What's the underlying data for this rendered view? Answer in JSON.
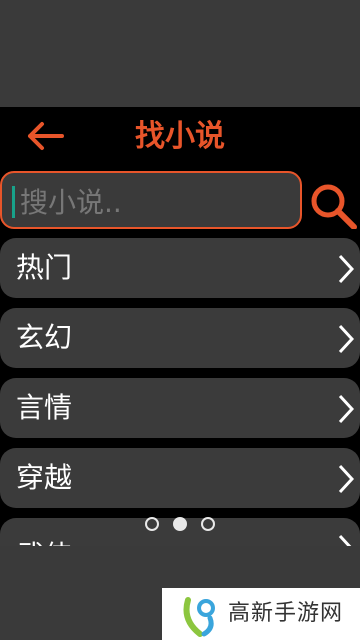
{
  "colors": {
    "accent": "#e8552a",
    "background": "#000000",
    "item_bg": "#3b3b3b",
    "caret": "#18a28a"
  },
  "header": {
    "back_icon": "arrow-left-icon",
    "title": "找小说"
  },
  "search": {
    "placeholder": "搜小说..",
    "button_icon": "search-icon"
  },
  "categories": [
    {
      "label": "热门",
      "icon": "chevron-right-icon"
    },
    {
      "label": "玄幻",
      "icon": "chevron-right-icon"
    },
    {
      "label": "言情",
      "icon": "chevron-right-icon"
    },
    {
      "label": "穿越",
      "icon": "chevron-right-icon"
    },
    {
      "label": "武侠",
      "icon": "chevron-right-icon"
    }
  ],
  "pager": {
    "total": 3,
    "active_index": 1
  },
  "watermark": {
    "text": "高新手游网"
  }
}
